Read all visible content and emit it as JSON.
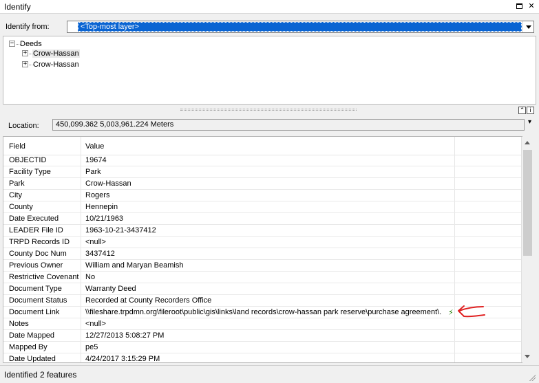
{
  "window": {
    "title": "Identify"
  },
  "identify_from": {
    "label": "Identify from:",
    "selected": "<Top-most layer>"
  },
  "tree": {
    "root": {
      "toggle": "−",
      "label": "Deeds"
    },
    "children": [
      {
        "toggle": "+",
        "label": "Crow-Hassan"
      },
      {
        "toggle": "+",
        "label": "Crow-Hassan"
      }
    ]
  },
  "location": {
    "label": "Location:",
    "value": "450,099.362  5,003,961.224 Meters"
  },
  "grid": {
    "headers": {
      "field": "Field",
      "value": "Value"
    },
    "rows": [
      {
        "field": "OBJECTID",
        "value": "19674"
      },
      {
        "field": "Facility Type",
        "value": "Park"
      },
      {
        "field": "Park",
        "value": "Crow-Hassan"
      },
      {
        "field": "City",
        "value": "Rogers"
      },
      {
        "field": "County",
        "value": "Hennepin"
      },
      {
        "field": "Date Executed",
        "value": "10/21/1963"
      },
      {
        "field": "LEADER File ID",
        "value": "1963-10-21-3437412"
      },
      {
        "field": "TRPD Records ID",
        "value": "<null>"
      },
      {
        "field": "County Doc Num",
        "value": "3437412"
      },
      {
        "field": "Previous Owner",
        "value": "William and Maryan Beamish"
      },
      {
        "field": "Restrictive Covenant",
        "value": "No"
      },
      {
        "field": "Document Type",
        "value": "Warranty Deed"
      },
      {
        "field": "Document Status",
        "value": "Recorded at County Recorders Office"
      },
      {
        "field": "Document Link",
        "value": "\\\\fileshare.trpdmn.org\\fileroot\\public\\gis\\links\\land records\\crow-hassan park reserve\\purchase agreement\\."
      },
      {
        "field": "Notes",
        "value": "<null>"
      },
      {
        "field": "Date Mapped",
        "value": "12/27/2013 5:08:27 PM"
      },
      {
        "field": "Mapped By",
        "value": "pe5"
      },
      {
        "field": "Date Updated",
        "value": "4/24/2017 3:15:29 PM"
      }
    ]
  },
  "status": {
    "text": "Identified 2 features"
  },
  "icons": {
    "hyperlink": "lightning-bolt-icon",
    "annotation": "red-arrow-annotation",
    "annotation_color": "#e02020",
    "selection_color": "#0a64d2"
  }
}
